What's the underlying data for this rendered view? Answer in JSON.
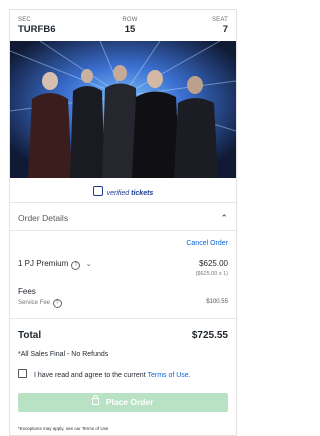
{
  "seat_info": {
    "sec_label": "SEC",
    "sec_value": "TURFB6",
    "row_label": "ROW",
    "row_value": "15",
    "seat_label": "SEAT",
    "seat_value": "7"
  },
  "verified": {
    "prefix": "verified",
    "suffix": "tickets"
  },
  "order_details": {
    "title": "Order Details",
    "cancel_label": "Cancel Order",
    "item_label": "1 PJ Premium",
    "item_price": "$625.00",
    "item_price_sub": "($625.00 x 1)",
    "fees_label": "Fees",
    "service_fee_label": "Service Fee",
    "service_fee_amount": "$100.55"
  },
  "total": {
    "label": "Total",
    "value": "$725.55"
  },
  "sales_final": "*All Sales Final - No Refunds",
  "terms": {
    "text": "I have read and agree to the current",
    "link": "Terms of Use."
  },
  "place_order_label": "Place Order",
  "footnote": "*Exceptions may apply, see our Terms of Use",
  "colors": {
    "accent": "#0a66d6",
    "button_disabled": "#b9e2c4",
    "brand_blue": "#1a3c8f"
  },
  "icons": [
    "verified-ticket-icon",
    "chevron-up-icon",
    "info-icon",
    "chevron-down-icon",
    "checkbox-icon",
    "lock-icon"
  ]
}
